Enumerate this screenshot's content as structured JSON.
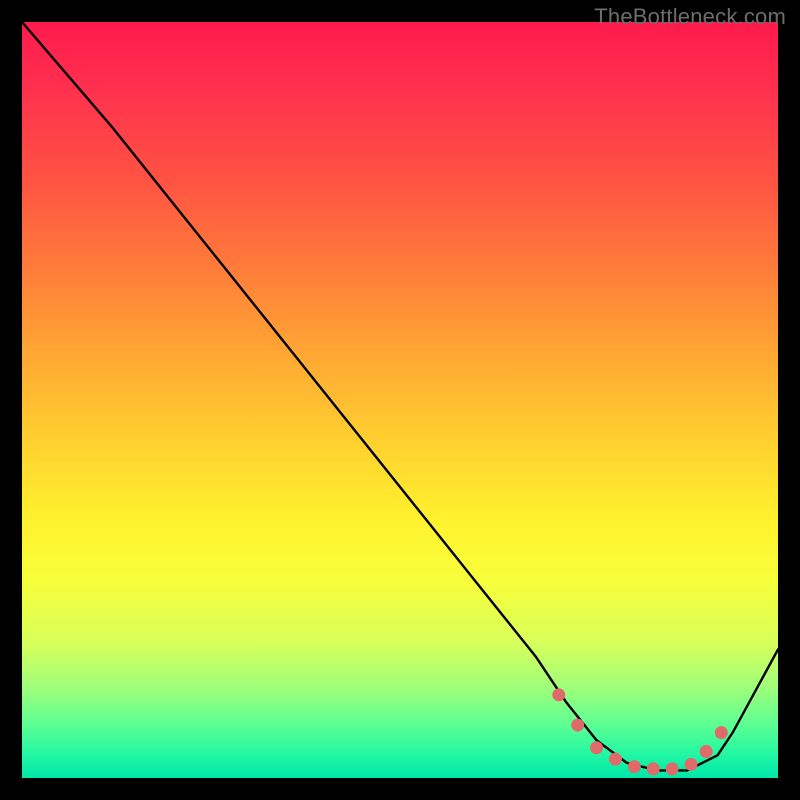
{
  "watermark": "TheBottleneck.com",
  "chart_data": {
    "type": "line",
    "title": "",
    "xlabel": "",
    "ylabel": "",
    "xlim": [
      0,
      100
    ],
    "ylim": [
      0,
      100
    ],
    "grid": false,
    "legend": false,
    "series": [
      {
        "name": "curve",
        "type": "line",
        "color": "#000000",
        "x": [
          0,
          6,
          12,
          20,
          28,
          36,
          44,
          52,
          60,
          68,
          72,
          76,
          80,
          84,
          88,
          92,
          94,
          100
        ],
        "y": [
          100,
          93,
          86,
          76,
          66,
          56,
          46,
          36,
          26,
          16,
          10,
          5,
          2,
          1,
          1,
          3,
          6,
          17
        ]
      },
      {
        "name": "markers",
        "type": "scatter",
        "color": "#e06a6a",
        "x": [
          71,
          73.5,
          76,
          78.5,
          81,
          83.5,
          86,
          88.5,
          90.5,
          92.5
        ],
        "y": [
          11,
          7,
          4,
          2.5,
          1.5,
          1.2,
          1.2,
          1.8,
          3.5,
          6
        ]
      }
    ]
  },
  "colors": {
    "background_frame": "#000000",
    "marker": "#e06a6a",
    "line": "#000000"
  }
}
